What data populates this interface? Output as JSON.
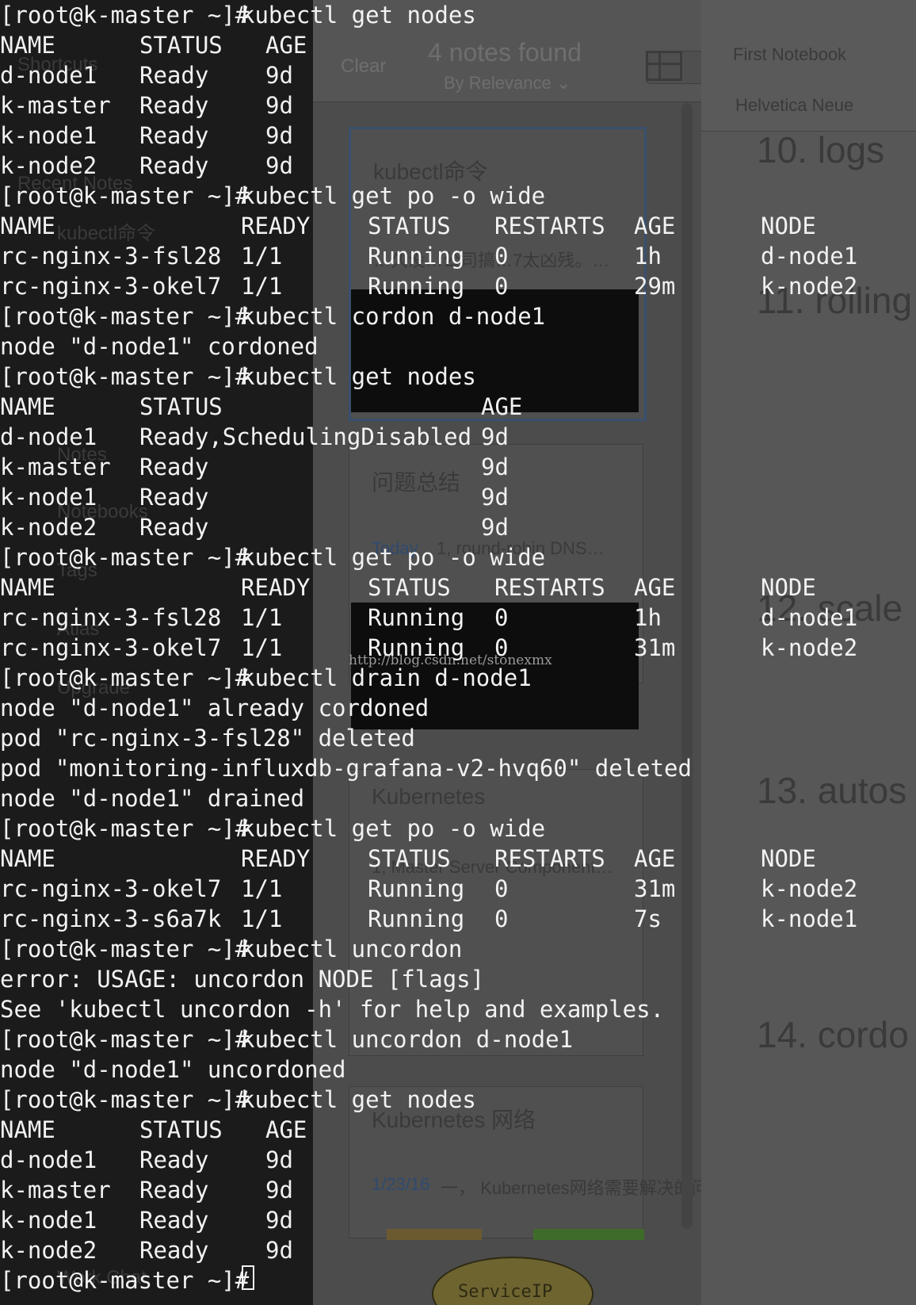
{
  "background_app": {
    "sidebar": [
      "Shortcuts",
      "Recent Notes",
      "kubectl命令",
      "Notes",
      "Notebooks",
      "Tags",
      "Atlas",
      "Upgrade",
      "Work Chat"
    ],
    "list_header": {
      "clear_label": "Clear",
      "count": "4 notes found",
      "sort": "By Relevance ⌄"
    },
    "cards": [
      {
        "title": "kubectl命令",
        "snippet": "…久没…公司搞…7太凶残。…"
      },
      {
        "title": "问题总结",
        "date": "Today",
        "snippet": "1, round-robin DNS…"
      },
      {
        "title": "Kubernetes",
        "snippet": "1, Master Server Component…"
      },
      {
        "title": "Kubernetes 网络",
        "date": "1/23/16",
        "snippet": "一， Kubernetes网络需要解决的问题 https://…"
      }
    ],
    "editor": {
      "notebook": "First Notebook",
      "font": "Helvetica Neue",
      "headings": [
        "10. logs",
        "11. rolling",
        "12. scale",
        "13. autos",
        "14. cordo"
      ]
    },
    "watermark": "http://blog.csdn.net/stonexmx",
    "diagram_label": "ServiceIP"
  },
  "terminal": {
    "prompt": "[root@k-master ~]#",
    "lines": [
      {
        "type": "prompt",
        "cmd": "kubectl get nodes"
      },
      {
        "type": "row",
        "cells": [
          "NAME",
          "STATUS",
          "AGE"
        ],
        "layout": "nodes"
      },
      {
        "type": "row",
        "cells": [
          "d-node1",
          "Ready",
          "9d"
        ],
        "layout": "nodes"
      },
      {
        "type": "row",
        "cells": [
          "k-master",
          "Ready",
          "9d"
        ],
        "layout": "nodes"
      },
      {
        "type": "row",
        "cells": [
          "k-node1",
          "Ready",
          "9d"
        ],
        "layout": "nodes"
      },
      {
        "type": "row",
        "cells": [
          "k-node2",
          "Ready",
          "9d"
        ],
        "layout": "nodes"
      },
      {
        "type": "prompt",
        "cmd": "kubectl get po -o wide"
      },
      {
        "type": "row",
        "cells": [
          "NAME",
          "READY",
          "STATUS",
          "RESTARTS",
          "AGE",
          "NODE"
        ],
        "layout": "pods"
      },
      {
        "type": "row",
        "cells": [
          "rc-nginx-3-fsl28",
          "1/1",
          "Running",
          "0",
          "1h",
          "d-node1"
        ],
        "layout": "pods"
      },
      {
        "type": "row",
        "cells": [
          "rc-nginx-3-okel7",
          "1/1",
          "Running",
          "0",
          "29m",
          "k-node2"
        ],
        "layout": "pods"
      },
      {
        "type": "prompt",
        "cmd": "kubectl cordon d-node1"
      },
      {
        "type": "text",
        "text": "node \"d-node1\" cordoned"
      },
      {
        "type": "prompt",
        "cmd": "kubectl get nodes"
      },
      {
        "type": "row",
        "cells": [
          "NAME",
          "STATUS",
          "AGE"
        ],
        "layout": "nodes2"
      },
      {
        "type": "row",
        "cells": [
          "d-node1",
          "Ready,SchedulingDisabled",
          "9d"
        ],
        "layout": "nodes2"
      },
      {
        "type": "row",
        "cells": [
          "k-master",
          "Ready",
          "9d"
        ],
        "layout": "nodes2"
      },
      {
        "type": "row",
        "cells": [
          "k-node1",
          "Ready",
          "9d"
        ],
        "layout": "nodes2"
      },
      {
        "type": "row",
        "cells": [
          "k-node2",
          "Ready",
          "9d"
        ],
        "layout": "nodes2"
      },
      {
        "type": "prompt",
        "cmd": "kubectl get po -o wide"
      },
      {
        "type": "row",
        "cells": [
          "NAME",
          "READY",
          "STATUS",
          "RESTARTS",
          "AGE",
          "NODE"
        ],
        "layout": "pods"
      },
      {
        "type": "row",
        "cells": [
          "rc-nginx-3-fsl28",
          "1/1",
          "Running",
          "0",
          "1h",
          "d-node1"
        ],
        "layout": "pods"
      },
      {
        "type": "row",
        "cells": [
          "rc-nginx-3-okel7",
          "1/1",
          "Running",
          "0",
          "31m",
          "k-node2"
        ],
        "layout": "pods"
      },
      {
        "type": "prompt",
        "cmd": "kubectl drain d-node1"
      },
      {
        "type": "text",
        "text": "node \"d-node1\" already cordoned"
      },
      {
        "type": "text",
        "text": "pod \"rc-nginx-3-fsl28\" deleted"
      },
      {
        "type": "text",
        "text": "pod \"monitoring-influxdb-grafana-v2-hvq60\" deleted"
      },
      {
        "type": "text",
        "text": "node \"d-node1\" drained"
      },
      {
        "type": "prompt",
        "cmd": "kubectl get po -o wide"
      },
      {
        "type": "row",
        "cells": [
          "NAME",
          "READY",
          "STATUS",
          "RESTARTS",
          "AGE",
          "NODE"
        ],
        "layout": "pods"
      },
      {
        "type": "row",
        "cells": [
          "rc-nginx-3-okel7",
          "1/1",
          "Running",
          "0",
          "31m",
          "k-node2"
        ],
        "layout": "pods"
      },
      {
        "type": "row",
        "cells": [
          "rc-nginx-3-s6a7k",
          "1/1",
          "Running",
          "0",
          "7s",
          "k-node1"
        ],
        "layout": "pods"
      },
      {
        "type": "prompt",
        "cmd": "kubectl uncordon"
      },
      {
        "type": "text",
        "text": "error: USAGE: uncordon NODE [flags]"
      },
      {
        "type": "text",
        "text": "See 'kubectl uncordon -h' for help and examples."
      },
      {
        "type": "prompt",
        "cmd": "kubectl uncordon d-node1"
      },
      {
        "type": "text",
        "text": "node \"d-node1\" uncordoned"
      },
      {
        "type": "prompt",
        "cmd": "kubectl get nodes"
      },
      {
        "type": "row",
        "cells": [
          "NAME",
          "STATUS",
          "AGE"
        ],
        "layout": "nodes"
      },
      {
        "type": "row",
        "cells": [
          "d-node1",
          "Ready",
          "9d"
        ],
        "layout": "nodes"
      },
      {
        "type": "row",
        "cells": [
          "k-master",
          "Ready",
          "9d"
        ],
        "layout": "nodes"
      },
      {
        "type": "row",
        "cells": [
          "k-node1",
          "Ready",
          "9d"
        ],
        "layout": "nodes"
      },
      {
        "type": "row",
        "cells": [
          "k-node2",
          "Ready",
          "9d"
        ],
        "layout": "nodes"
      },
      {
        "type": "cursor"
      }
    ]
  }
}
